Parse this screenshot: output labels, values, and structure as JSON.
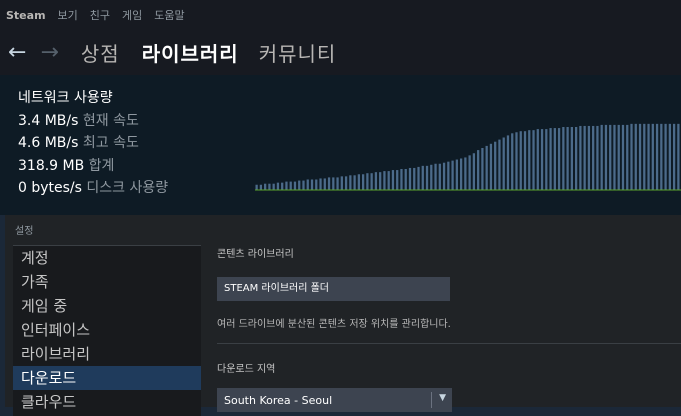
{
  "menubar": {
    "app": "Steam",
    "items": [
      "보기",
      "친구",
      "게임",
      "도움말"
    ]
  },
  "nav": {
    "tabs": {
      "store": "상점",
      "library": "라이브러리",
      "community": "커뮤니티"
    }
  },
  "downloads": {
    "heading": "네트워크 사용량",
    "current_speed": {
      "value": "3.4 MB/s",
      "label": "현재 속도"
    },
    "peak_speed": {
      "value": "4.6 MB/s",
      "label": "최고 속도"
    },
    "total": {
      "value": "318.9 MB",
      "label": "합계"
    },
    "disk": {
      "value": "0 bytes/s",
      "label": "디스크 사용량"
    },
    "graph_levels": [
      0.05,
      0.05,
      0.06,
      0.06,
      0.06,
      0.07,
      0.07,
      0.08,
      0.08,
      0.08,
      0.09,
      0.09,
      0.1,
      0.1,
      0.1,
      0.11,
      0.11,
      0.12,
      0.12,
      0.12,
      0.13,
      0.13,
      0.14,
      0.14,
      0.15,
      0.15,
      0.16,
      0.16,
      0.17,
      0.17,
      0.18,
      0.18,
      0.19,
      0.19,
      0.2,
      0.2,
      0.21,
      0.21,
      0.22,
      0.23,
      0.23,
      0.24,
      0.25,
      0.25,
      0.26,
      0.27,
      0.28,
      0.29,
      0.3,
      0.31,
      0.33,
      0.35,
      0.38,
      0.4,
      0.42,
      0.44,
      0.46,
      0.48,
      0.5,
      0.52,
      0.54,
      0.55,
      0.56,
      0.56,
      0.57,
      0.57,
      0.58,
      0.58,
      0.58,
      0.59,
      0.59,
      0.59,
      0.6,
      0.6,
      0.6,
      0.6,
      0.61,
      0.61,
      0.61,
      0.61,
      0.61,
      0.62,
      0.62,
      0.62,
      0.62,
      0.62,
      0.62,
      0.62,
      0.63,
      0.63,
      0.63,
      0.63,
      0.63,
      0.63,
      0.63,
      0.63,
      0.63,
      0.63,
      0.63,
      0.63
    ]
  },
  "settings": {
    "title": "설정",
    "sidebar": [
      "계정",
      "가족",
      "게임 중",
      "인터페이스",
      "라이브러리",
      "다운로드",
      "클라우드"
    ],
    "active_index": 5,
    "content": {
      "library_section": "콘텐츠 라이브러리",
      "library_button": "STEAM 라이브러리 폴더",
      "library_desc": "여러 드라이브에 분산된 콘텐츠 저장 위치를 관리합니다.",
      "region_section": "다운로드 지역",
      "region_value": "South Korea - Seoul"
    }
  },
  "colors": {
    "accent": "#1f3b5c",
    "graph_bar": "#4c6b8a",
    "graph_baseline": "#5ba32b"
  }
}
